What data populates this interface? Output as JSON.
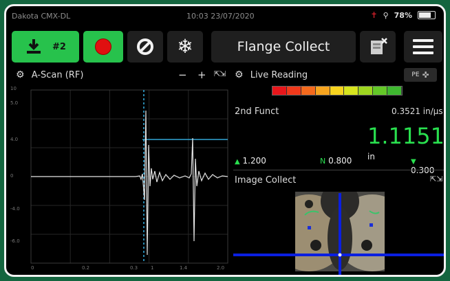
{
  "status": {
    "device": "Dakota CMX-DL",
    "datetime": "10:03 23/07/2020",
    "battery": "78%",
    "battery_level": 0.78
  },
  "toolbar": {
    "save_count": "#2",
    "mode_label": "Flange Collect"
  },
  "ascan": {
    "title": "A-Scan (RF)",
    "zoom_out": "−",
    "zoom_in": "+",
    "y_ticks": [
      "10",
      "5.0",
      "4.0",
      "0",
      "-4.0",
      "-6.0"
    ],
    "x_ticks": [
      "0",
      "0.2",
      "0.3",
      "1",
      "1.4",
      "2.0"
    ]
  },
  "live": {
    "title": "Live Reading",
    "pe_label": "PE",
    "function_label": "2nd Funct",
    "velocity": "0.3521 in/µs",
    "reading": "1.1151",
    "reading_unit": "in",
    "alarm_high": "1.200",
    "nominal": "0.800",
    "alarm_low": "0.300",
    "colors": [
      "#e8161b",
      "#f0391b",
      "#f56a1d",
      "#f7a51f",
      "#f8d41f",
      "#d7e51e",
      "#9ed620",
      "#64c828",
      "#3fb830"
    ]
  },
  "image": {
    "title": "Image Collect"
  },
  "colors": {
    "accent_green": "#27c24c",
    "reading_green": "#29e04f",
    "crosshair": "#0a1fe0",
    "gate": "#33a8d8"
  }
}
